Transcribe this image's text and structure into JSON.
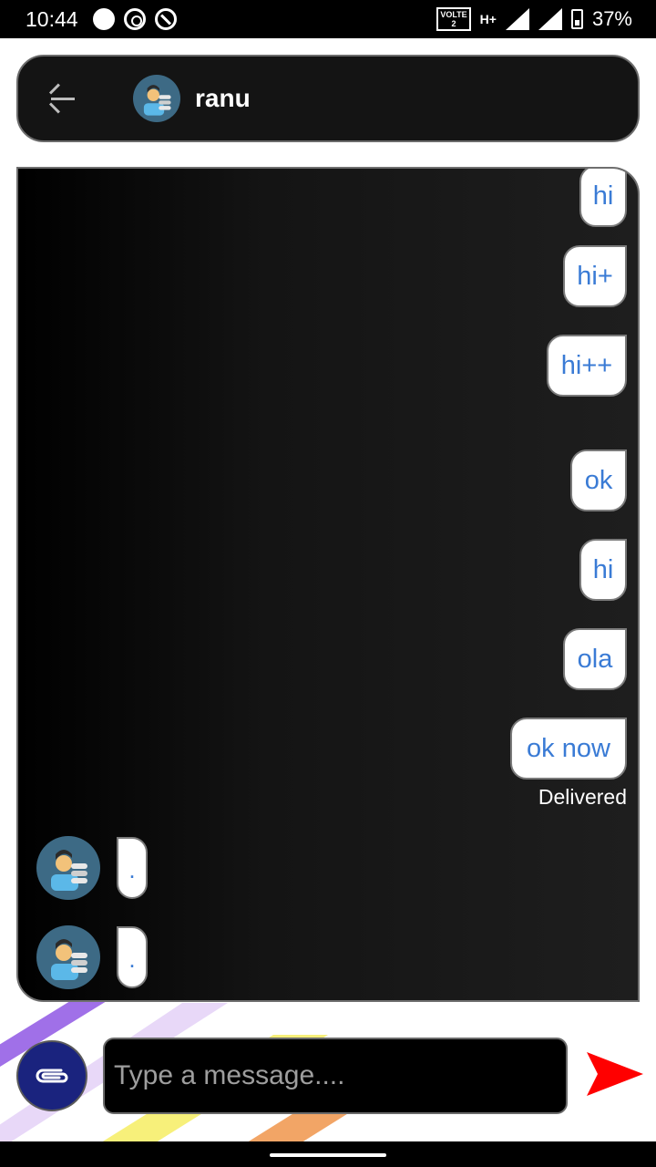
{
  "status_bar": {
    "time": "10:44",
    "volte_label": "VOLTE",
    "sim_slot": "2",
    "network_type": "H+",
    "battery_percent": "37%"
  },
  "header": {
    "contact_name": "ranu"
  },
  "messages": {
    "outgoing": [
      "hi",
      "hi+",
      "hi++",
      "ok",
      "hi",
      "ola",
      "ok now"
    ],
    "delivered_label": "Delivered",
    "incoming": [
      ".",
      "."
    ]
  },
  "composer": {
    "placeholder": "Type a message....",
    "value": ""
  },
  "colors": {
    "bubble_text": "#3a7bd5",
    "attach_button": "#1a237e",
    "send_icon": "#ff0000"
  },
  "icons": {
    "back": "back-arrow-icon",
    "attach": "paperclip-icon",
    "send": "send-icon",
    "avatar": "user-avatar-icon"
  }
}
